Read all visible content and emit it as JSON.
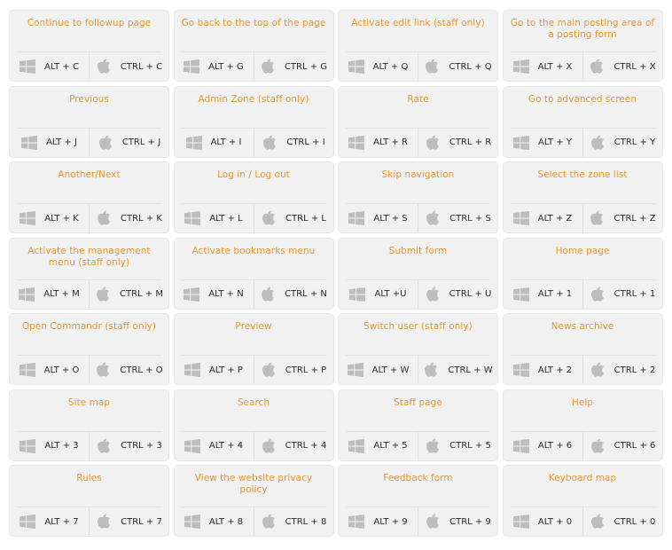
{
  "colors": {
    "title": "#e8962f",
    "card_bg": "#f1f1f1",
    "icon": "#bdbdbd",
    "key_text": "#2a2a2a"
  },
  "icons": {
    "windows": "windows-icon",
    "apple": "apple-icon"
  },
  "cards": [
    {
      "title": "Continue to followup page",
      "win": "ALT + C",
      "mac": "CTRL + C"
    },
    {
      "title": "Go back to the top of the page",
      "win": "ALT + G",
      "mac": "CTRL + G"
    },
    {
      "title": "Activate edit link (staff only)",
      "win": "ALT + Q",
      "mac": "CTRL + Q"
    },
    {
      "title": "Go to the main posting area of a posting form",
      "win": "ALT + X",
      "mac": "CTRL + X"
    },
    {
      "title": "Previous",
      "win": "ALT + J",
      "mac": "CTRL + J"
    },
    {
      "title": "Admin Zone (staff only)",
      "win": "ALT + I",
      "mac": "CTRL + I"
    },
    {
      "title": "Rate",
      "win": "ALT + R",
      "mac": "CTRL + R"
    },
    {
      "title": "Go to advanced screen",
      "win": "ALT + Y",
      "mac": "CTRL + Y"
    },
    {
      "title": "Another/Next",
      "win": "ALT + K",
      "mac": "CTRL + K"
    },
    {
      "title": "Log in / Log out",
      "win": "ALT + L",
      "mac": "CTRL + L"
    },
    {
      "title": "Skip navigation",
      "win": "ALT + S",
      "mac": "CTRL + S"
    },
    {
      "title": "Select the zone list",
      "win": "ALT + Z",
      "mac": "CTRL + Z"
    },
    {
      "title": "Activate the management menu (staff only)",
      "win": "ALT + M",
      "mac": "CTRL + M"
    },
    {
      "title": "Activate bookmarks menu",
      "win": "ALT + N",
      "mac": "CTRL + N"
    },
    {
      "title": "Submit form",
      "win": "ALT +U",
      "mac": "CTRL + U"
    },
    {
      "title": "Home page",
      "win": "ALT + 1",
      "mac": "CTRL + 1"
    },
    {
      "title": "Open Commandr (staff only)",
      "win": "ALT + O",
      "mac": "CTRL + O"
    },
    {
      "title": "Preview",
      "win": "ALT + P",
      "mac": "CTRL + P"
    },
    {
      "title": "Switch user (staff only)",
      "win": "ALT + W",
      "mac": "CTRL + W"
    },
    {
      "title": "News archive",
      "win": "ALT + 2",
      "mac": "CTRL + 2"
    },
    {
      "title": "Site map",
      "win": "ALT + 3",
      "mac": "CTRL + 3"
    },
    {
      "title": "Search",
      "win": "ALT + 4",
      "mac": "CTRL + 4"
    },
    {
      "title": "Staff page",
      "win": "ALT + 5",
      "mac": "CTRL + 5"
    },
    {
      "title": "Help",
      "win": "ALT + 6",
      "mac": "CTRL + 6"
    },
    {
      "title": "Rules",
      "win": "ALT + 7",
      "mac": "CTRL + 7"
    },
    {
      "title": "View the website privacy policy",
      "win": "ALT + 8",
      "mac": "CTRL + 8"
    },
    {
      "title": "Feedback form",
      "win": "ALT + 9",
      "mac": "CTRL + 9"
    },
    {
      "title": "Keyboard map",
      "win": "ALT + 0",
      "mac": "CTRL + 0"
    }
  ]
}
